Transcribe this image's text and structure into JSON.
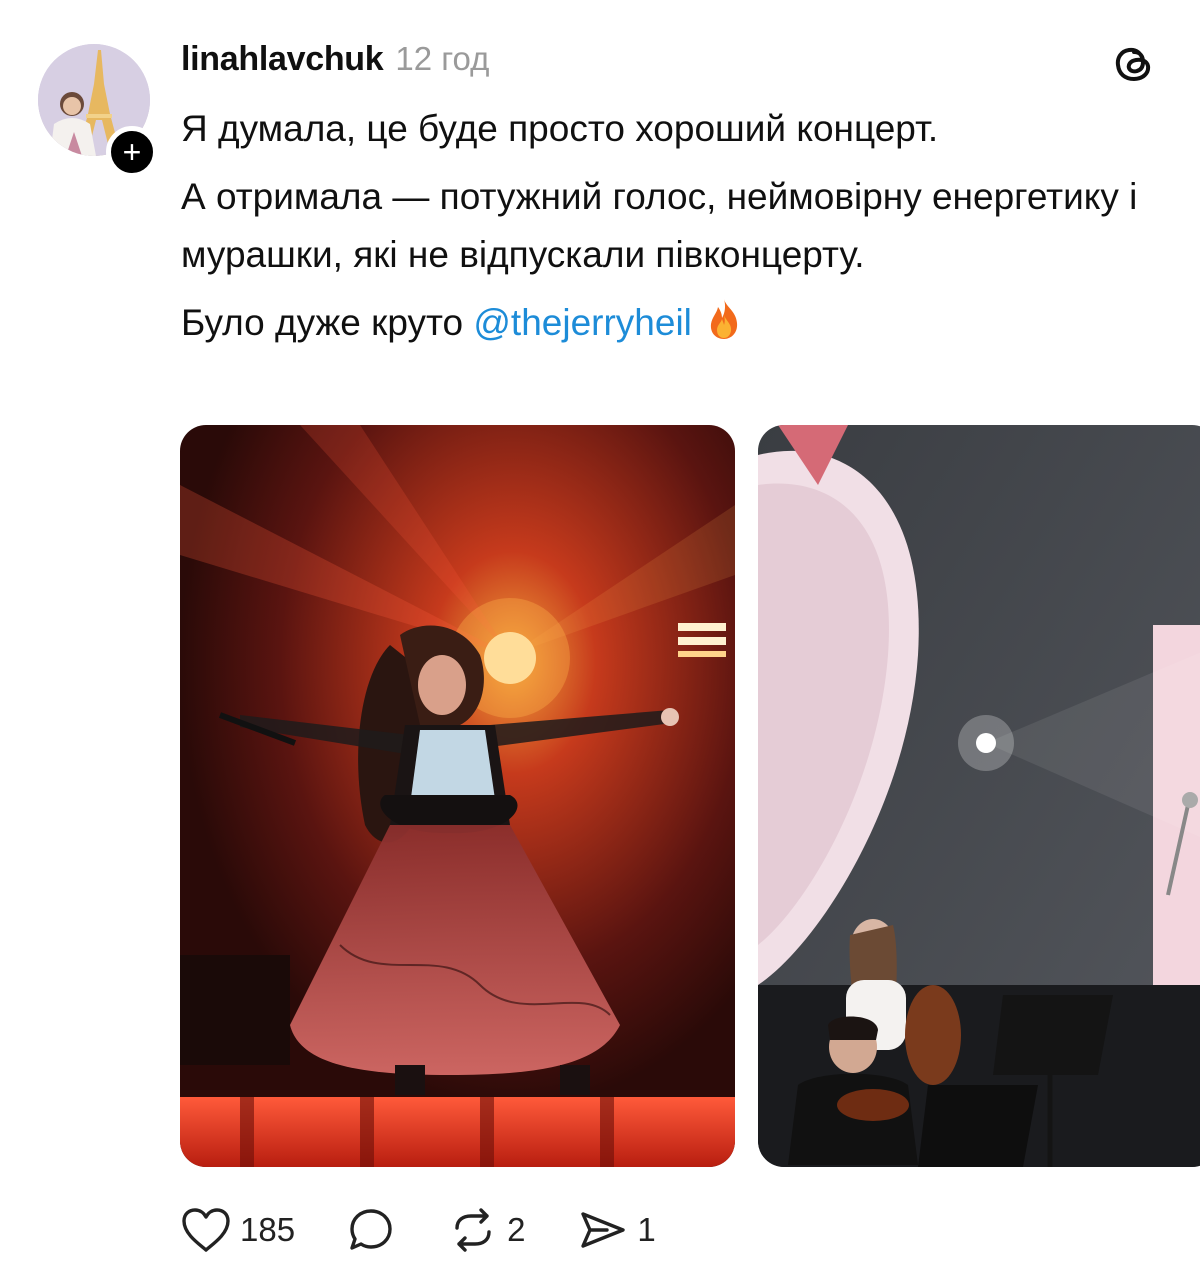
{
  "post": {
    "username": "linahlavchuk",
    "time": "12 год",
    "follow_symbol": "+",
    "lines": [
      "Я думала, це буде просто хороший концерт.",
      "А отримала — потужний голос, неймовірну енергетику і мурашки, які не відпускали півконцерту."
    ],
    "last_line_prefix": "Було дуже круто ",
    "mention": "@thejerryheil"
  },
  "actions": {
    "likes": "185",
    "reposts": "2",
    "shares": "1"
  },
  "icons": {
    "app": "threads-logo-icon",
    "like": "heart-icon",
    "comment": "comment-bubble-icon",
    "repost": "repost-arrows-icon",
    "share": "send-icon",
    "emoji": "fire-emoji"
  },
  "colors": {
    "mention": "#1d8cd8",
    "time": "#9a9a9a",
    "text": "#101010"
  }
}
